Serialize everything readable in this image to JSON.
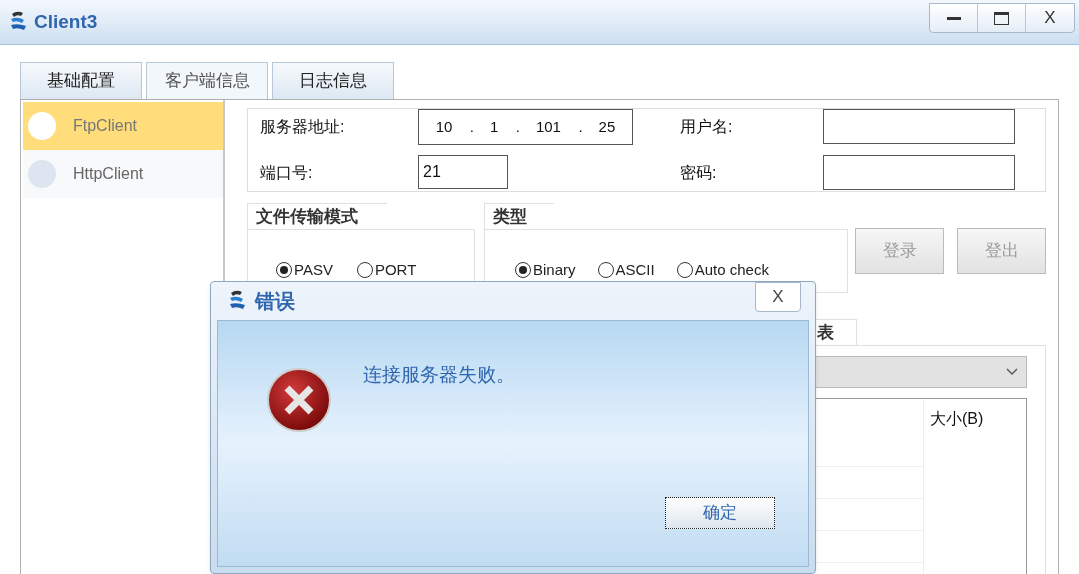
{
  "window": {
    "title": "Client3",
    "close_label": "X"
  },
  "tabs": [
    {
      "label": "基础配置",
      "selected": false
    },
    {
      "label": "客户端信息",
      "selected": true
    },
    {
      "label": "日志信息",
      "selected": false
    }
  ],
  "sidebar": {
    "items": [
      {
        "label": "FtpClient",
        "selected": true
      },
      {
        "label": "HttpClient",
        "selected": false
      }
    ]
  },
  "login_form": {
    "server_address": {
      "label": "服务器地址:",
      "octets": [
        "10",
        "1",
        "101",
        "25"
      ],
      "separator": "."
    },
    "port": {
      "label": "端口号:",
      "value": "21"
    },
    "username": {
      "label": "用户名:"
    },
    "password": {
      "label": "密码:"
    }
  },
  "transfer_mode": {
    "title": "文件传输模式",
    "options": [
      {
        "label": "PASV",
        "selected": true
      },
      {
        "label": "PORT",
        "selected": false
      }
    ]
  },
  "type": {
    "title": "类型",
    "options": [
      {
        "label": "Binary",
        "selected": true
      },
      {
        "label": "ASCII",
        "selected": false
      },
      {
        "label": "Auto check",
        "selected": false
      }
    ]
  },
  "buttons": [
    {
      "label": "登录",
      "disabled": true
    },
    {
      "label": "登出",
      "disabled": true
    }
  ],
  "file_list": {
    "tab_label": "表",
    "columns": [
      "大小(B)"
    ]
  },
  "dialog": {
    "title": "错误",
    "close_label": "X",
    "message": "连接服务器失败。",
    "button": "确定"
  }
}
